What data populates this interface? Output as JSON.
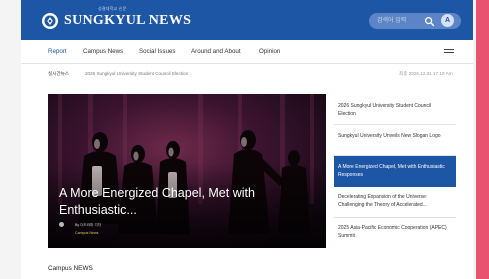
{
  "colors": {
    "brand": "#1e56a6",
    "accent_strip": "#e9536f",
    "active_item": "#1e56a6"
  },
  "header": {
    "logo_text": "SUNGKYUL NEWS",
    "logo_subtext": "성결대학교 신문",
    "search_placeholder": "검색어 입력",
    "search_icon": "search-icon",
    "user_initial": "A"
  },
  "nav": {
    "items": [
      {
        "label": "Report"
      },
      {
        "label": "Campus News"
      },
      {
        "label": "Social Issues"
      },
      {
        "label": "Around and About"
      },
      {
        "label": "Opinion"
      }
    ],
    "active_index": 0,
    "menu_icon": "hamburger-menu-icon"
  },
  "breaking": {
    "label": "실시간뉴스",
    "headline": "2026 Sungkyul University Student Council Election",
    "date": "최종 2026.12.31 17:10 Am"
  },
  "hero": {
    "title": "A More Energized Chapel, Met with Enthusiastic...",
    "author": "By 더드라마 기자",
    "section": "Campus News"
  },
  "side_list": {
    "items": [
      {
        "title": "2026 Sungkyul University Student Council Election"
      },
      {
        "title": "Sungkyul University Unveils New Slogan Logo"
      },
      {
        "title": "A More Energized Chapel, Met with Enthusiastic Responses"
      },
      {
        "title": "Decelerating Expansion of the Universe: Challenging the Theory of Accelerated..."
      },
      {
        "title": "2025 Asia-Pacific Economic Cooperation (APEC) Summit"
      }
    ],
    "active_index": 2
  },
  "sections": {
    "campus_heading": "Campus NEWS"
  }
}
